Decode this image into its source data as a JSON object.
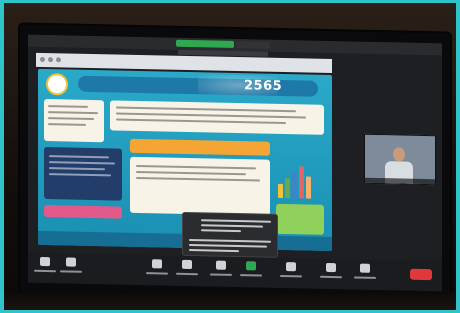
{
  "slide": {
    "year_title": "2565"
  },
  "colors": {
    "border": "#2ec4c9",
    "slide_background": "#2aa9c9",
    "share_button": "#2fa84f",
    "end_button": "#e0383b"
  },
  "icons": [
    "microphone-icon",
    "video-icon",
    "security-icon",
    "participants-icon",
    "chat-icon",
    "share-screen-icon",
    "record-icon",
    "breakout-icon",
    "reactions-icon"
  ]
}
